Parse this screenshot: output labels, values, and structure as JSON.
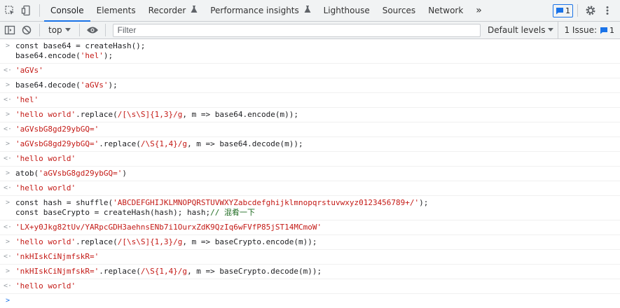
{
  "tabs": [
    {
      "label": "Console",
      "active": true
    },
    {
      "label": "Elements",
      "active": false
    },
    {
      "label": "Recorder",
      "active": false,
      "icon": "flask-icon"
    },
    {
      "label": "Performance insights",
      "active": false,
      "icon": "flask-icon"
    },
    {
      "label": "Lighthouse",
      "active": false
    },
    {
      "label": "Sources",
      "active": false
    },
    {
      "label": "Network",
      "active": false
    }
  ],
  "toolbar": {
    "overflow": "»",
    "messages_count": "1",
    "context": "top",
    "filter_placeholder": "Filter",
    "levels": "Default levels",
    "issues_label": "1 Issue:",
    "issues_count": "1"
  },
  "entries": [
    {
      "kind": "input",
      "segments": [
        [
          "plain",
          "const base64 = createHash();\nbase64.encode("
        ],
        [
          "str",
          "'hel'"
        ],
        [
          "plain",
          ");"
        ]
      ]
    },
    {
      "kind": "output",
      "segments": [
        [
          "res",
          "'aGVs'"
        ]
      ]
    },
    {
      "kind": "input",
      "segments": [
        [
          "plain",
          "base64.decode("
        ],
        [
          "str",
          "'aGVs'"
        ],
        [
          "plain",
          ");"
        ]
      ]
    },
    {
      "kind": "output",
      "segments": [
        [
          "res",
          "'hel'"
        ]
      ]
    },
    {
      "kind": "input",
      "segments": [
        [
          "str",
          "'hello world'"
        ],
        [
          "plain",
          ".replace("
        ],
        [
          "str",
          "/[\\s\\S]{1,3}/g"
        ],
        [
          "plain",
          ", m => base64.encode(m));"
        ]
      ]
    },
    {
      "kind": "output",
      "segments": [
        [
          "res",
          "'aGVsbG8gd29ybGQ='"
        ]
      ]
    },
    {
      "kind": "input",
      "segments": [
        [
          "str",
          "'aGVsbG8gd29ybGQ='"
        ],
        [
          "plain",
          ".replace("
        ],
        [
          "str",
          "/\\S{1,4}/g"
        ],
        [
          "plain",
          ", m => base64.decode(m));"
        ]
      ]
    },
    {
      "kind": "output",
      "segments": [
        [
          "res",
          "'hello world'"
        ]
      ]
    },
    {
      "kind": "input",
      "segments": [
        [
          "plain",
          "atob("
        ],
        [
          "str",
          "'aGVsbG8gd29ybGQ='"
        ],
        [
          "plain",
          ")"
        ]
      ]
    },
    {
      "kind": "output",
      "segments": [
        [
          "res",
          "'hello world'"
        ]
      ]
    },
    {
      "kind": "input",
      "segments": [
        [
          "plain",
          "const hash = shuffle("
        ],
        [
          "str",
          "'ABCDEFGHIJKLMNOPQRSTUVWXYZabcdefghijklmnopqrstuvwxyz0123456789+/'"
        ],
        [
          "plain",
          ");\nconst baseCrypto = createHash(hash); hash;"
        ],
        [
          "cmt",
          "// 混肴一下"
        ]
      ]
    },
    {
      "kind": "output",
      "segments": [
        [
          "res",
          "'LX+y0Jkg82tUv/YARpcGDH3aehnsENb7i1OurxZdK9QzIq6wFVfP85jST14MCmoW'"
        ]
      ]
    },
    {
      "kind": "input",
      "segments": [
        [
          "str",
          "'hello world'"
        ],
        [
          "plain",
          ".replace("
        ],
        [
          "str",
          "/[\\s\\S]{1,3}/g"
        ],
        [
          "plain",
          ", m => baseCrypto.encode(m));"
        ]
      ]
    },
    {
      "kind": "output",
      "segments": [
        [
          "res",
          "'nkHIskCiNjmfskR='"
        ]
      ]
    },
    {
      "kind": "input",
      "segments": [
        [
          "str",
          "'nkHIskCiNjmfskR='"
        ],
        [
          "plain",
          ".replace("
        ],
        [
          "str",
          "/\\S{1,4}/g"
        ],
        [
          "plain",
          ", m => baseCrypto.decode(m));"
        ]
      ]
    },
    {
      "kind": "output",
      "segments": [
        [
          "res",
          "'hello world'"
        ]
      ]
    }
  ]
}
